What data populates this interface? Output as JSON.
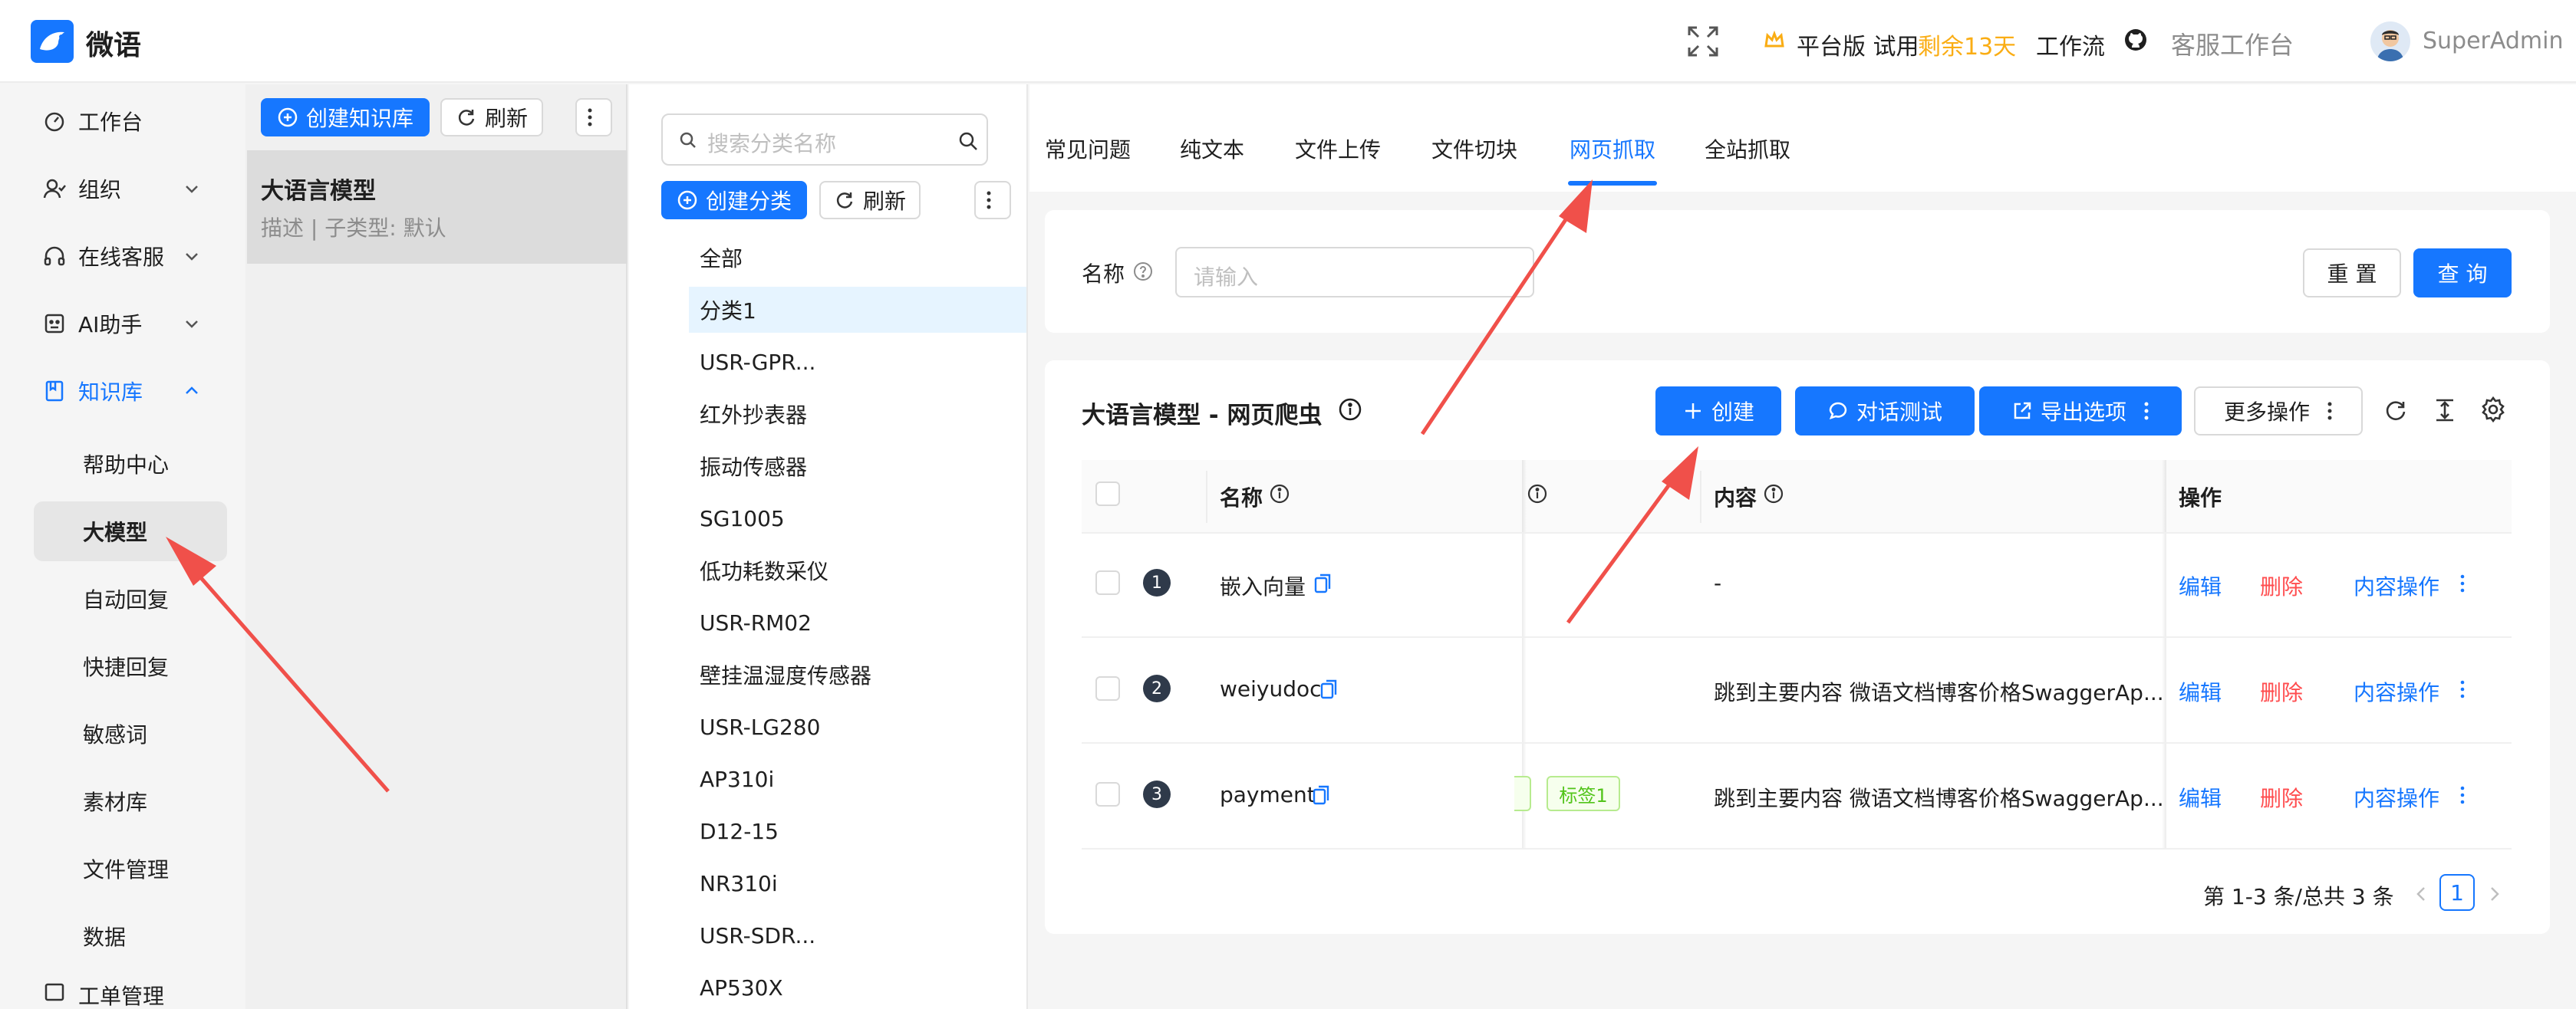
{
  "header": {
    "app_name": "微语",
    "plan_label": "平台版 试用",
    "trial_remaining": "剩余13天",
    "workflow_label": "工作流",
    "service_desk_label": "客服工作台",
    "username": "SuperAdmin"
  },
  "sidebar": {
    "items": [
      {
        "label": "工作台"
      },
      {
        "label": "组织"
      },
      {
        "label": "在线客服"
      },
      {
        "label": "AI助手"
      },
      {
        "label": "知识库"
      }
    ],
    "sub_items": [
      {
        "label": "帮助中心"
      },
      {
        "label": "大模型"
      },
      {
        "label": "自动回复"
      },
      {
        "label": "快捷回复"
      },
      {
        "label": "敏感词"
      },
      {
        "label": "素材库"
      },
      {
        "label": "文件管理"
      },
      {
        "label": "数据"
      }
    ],
    "partial_item": "工单管理"
  },
  "kb_panel": {
    "create_label": "创建知识库",
    "refresh_label": "刷新",
    "selected_title": "大语言模型",
    "selected_desc": "描述 | 子类型: 默认"
  },
  "category_panel": {
    "search_placeholder": "搜索分类名称",
    "create_label": "创建分类",
    "refresh_label": "刷新",
    "items": [
      "全部",
      "分类1",
      "USR-GPR...",
      "红外抄表器",
      "振动传感器",
      "SG1005",
      "低功耗数采仪",
      "USR-RM02",
      "壁挂温湿度传感器",
      "USR-LG280",
      "AP310i",
      "D12-15",
      "NR310i",
      "USR-SDR...",
      "AP530X"
    ]
  },
  "tabs": [
    "常见问题",
    "纯文本",
    "文件上传",
    "文件切块",
    "网页抓取",
    "全站抓取"
  ],
  "active_tab": "网页抓取",
  "filter": {
    "name_label": "名称",
    "name_placeholder": "请输入",
    "reset_label": "重 置",
    "query_label": "查 询"
  },
  "table": {
    "title": "大语言模型 - 网页爬虫",
    "create_label": "创建",
    "chat_test_label": "对话测试",
    "export_label": "导出选项",
    "more_label": "更多操作",
    "columns": {
      "name": "名称",
      "content": "内容",
      "actions": "操作"
    },
    "rows": [
      {
        "index": "1",
        "name": "嵌入向量",
        "tag": "",
        "content": "-"
      },
      {
        "index": "2",
        "name": "weiyudoc",
        "tag": "",
        "content": "跳到主要内容 微语文档博客价格SwaggerAp..."
      },
      {
        "index": "3",
        "name": "payment",
        "tag": "标签1",
        "content": "跳到主要内容 微语文档博客价格SwaggerAp..."
      }
    ],
    "action_edit": "编辑",
    "action_delete": "删除",
    "action_content": "内容操作",
    "pagination_text": "第 1-3 条/总共 3 条",
    "current_page": "1"
  },
  "colors": {
    "primary": "#1677ff",
    "danger": "#ff4d4f",
    "warning": "#faad14",
    "annotation_arrow": "#f0504a"
  }
}
